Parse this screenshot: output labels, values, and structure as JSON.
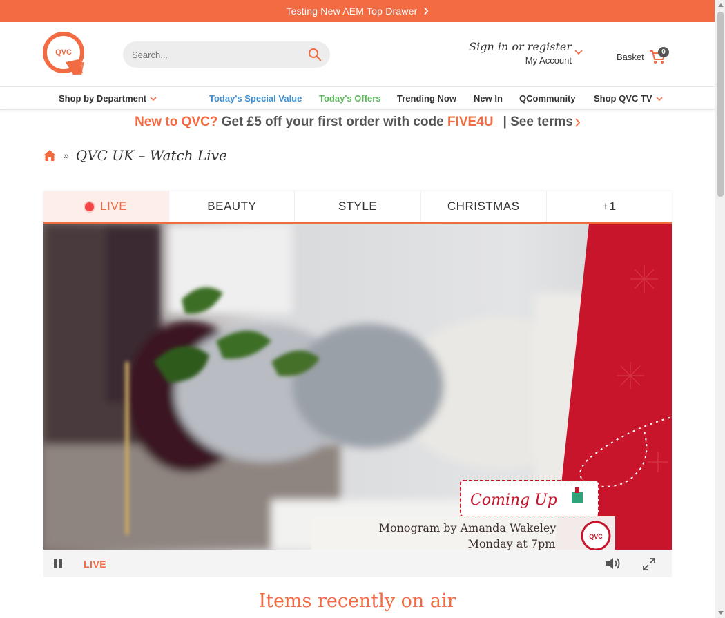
{
  "top_drawer": {
    "text": "Testing New AEM Top Drawer",
    "background": "#f26b43"
  },
  "header": {
    "logo_text": "QVC",
    "search": {
      "placeholder": "Search...",
      "value": ""
    },
    "account": {
      "sign_in": "Sign in or register",
      "my_account": "My Account"
    },
    "basket": {
      "label": "Basket",
      "count": "0"
    }
  },
  "nav": {
    "items": [
      {
        "label": "Shop by Department"
      },
      {
        "label": "Today's Special Value"
      },
      {
        "label": "Today's Offers"
      },
      {
        "label": "Trending Now"
      },
      {
        "label": "New In"
      },
      {
        "label": "QCommunity"
      },
      {
        "label": "Shop QVC TV"
      }
    ]
  },
  "promo": {
    "lead": "New to QVC?",
    "middle": "Get £5 off your first order with code",
    "code": "FIVE4U",
    "terms": "| See terms"
  },
  "breadcrumb": {
    "current": "QVC UK – Watch Live",
    "separator": "»"
  },
  "tabs": [
    {
      "label": "LIVE",
      "active": true
    },
    {
      "label": "BEAUTY"
    },
    {
      "label": "STYLE"
    },
    {
      "label": "CHRISTMAS"
    },
    {
      "label": "+1"
    }
  ],
  "video": {
    "coming_up": "Coming Up",
    "show_title": "Monogram by Amanda Wakeley",
    "show_time": "Monday at 7pm",
    "channel_logo": "QVC"
  },
  "controls": {
    "live_label": "LIVE"
  },
  "section": {
    "recent_title": "Items recently on air"
  },
  "colors": {
    "accent": "#f26b43",
    "blue_link": "#3d8fd1",
    "green_link": "#5cb85c",
    "live_dot": "#f24545"
  }
}
